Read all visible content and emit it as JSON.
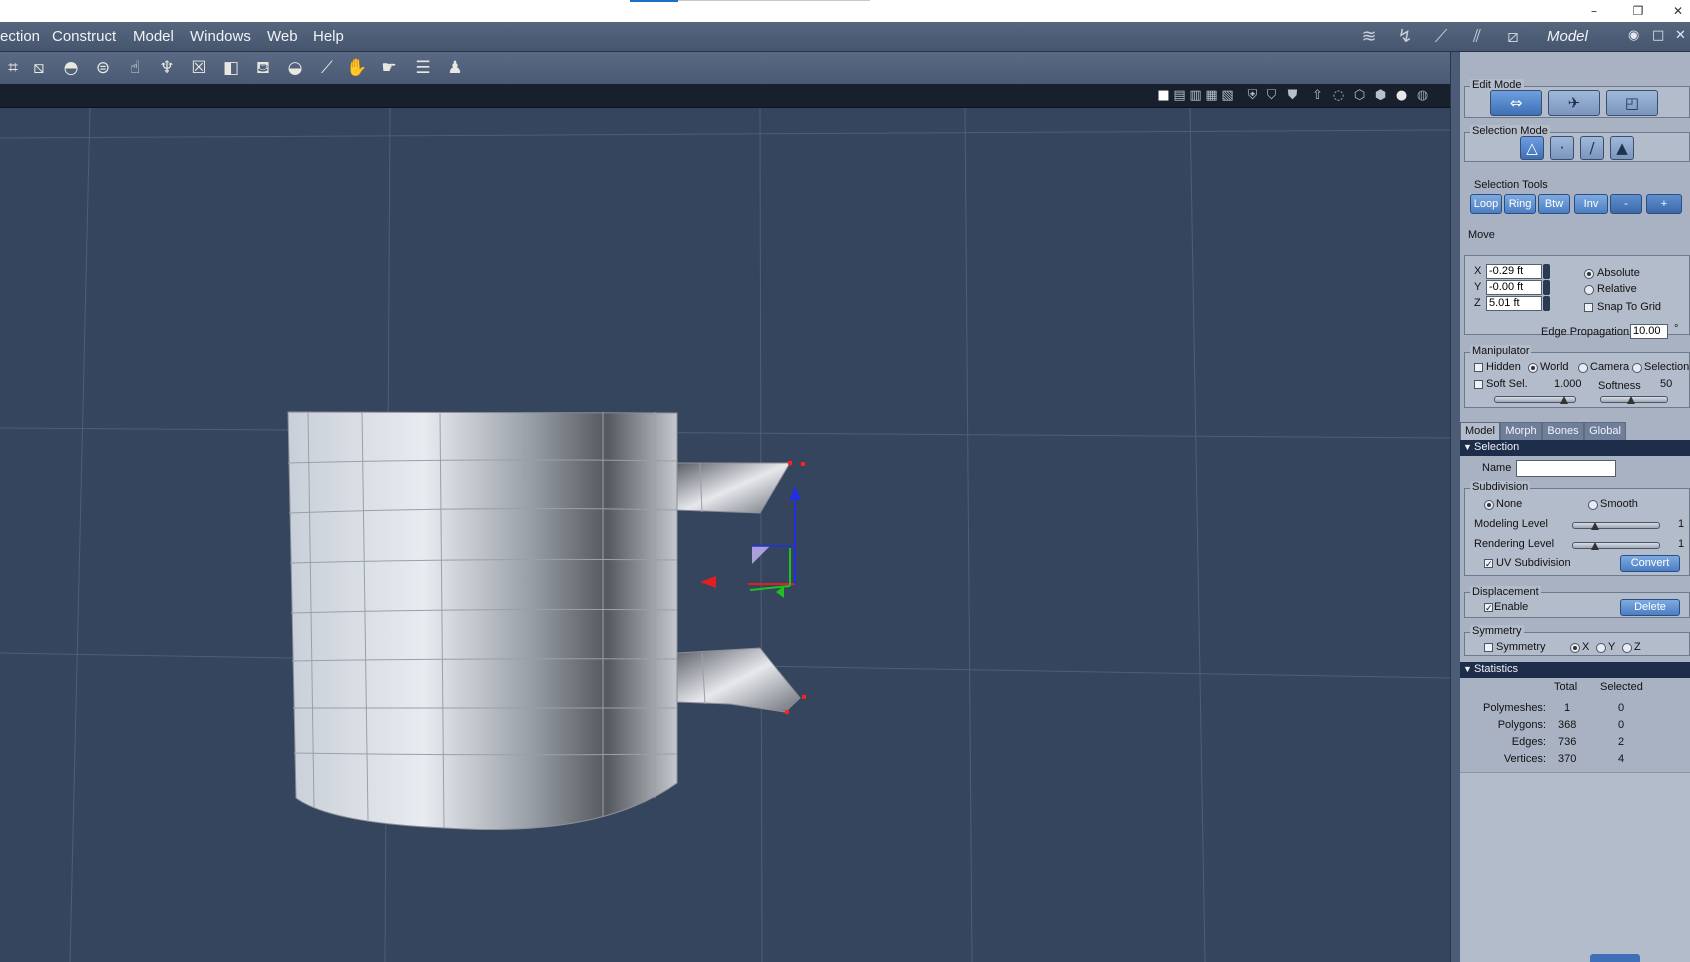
{
  "menu": {
    "items": [
      "ection",
      "Construct",
      "Model",
      "Windows",
      "Web",
      "Help"
    ],
    "room_title": "Model",
    "room_icons": [
      "pose-room-icon",
      "material-room-icon",
      "face-room-icon",
      "hair-room-icon",
      "cloth-room-icon"
    ]
  },
  "toolbar": {
    "tools": [
      "vertex-tool-icon",
      "frame-tool-icon",
      "dome-icon",
      "cylinder-shape-icon",
      "hand-shape-icon",
      "goblet-icon",
      "box-frame-icon",
      "cube-icon",
      "bag-icon",
      "bowl-icon",
      "knife-icon",
      "hand-move-icon",
      "hand-point-icon",
      "layers-icon",
      "figure-icon"
    ]
  },
  "viewport_bar": {
    "layout_icons": [
      "single-view-icon",
      "two-view-icon",
      "three-view-icon",
      "four-view-icon",
      "custom-view-icon"
    ],
    "display_icons": [
      "shield-icon",
      "shield-outline-icon",
      "shield-dot-icon",
      "arrow-up-icon",
      "dotted-sphere-icon",
      "wire-cube-icon",
      "shaded-cube-icon",
      "sphere-icon",
      "textured-sphere-icon"
    ]
  },
  "panel": {
    "edit_mode": {
      "title": "Edit Mode"
    },
    "selection_mode": {
      "title": "Selection Mode"
    },
    "selection_tools": {
      "title": "Selection Tools",
      "buttons": [
        "Loop",
        "Ring",
        "Btw",
        "Inv",
        "-",
        "+"
      ]
    },
    "move": {
      "title": "Move",
      "x_label": "X",
      "x_value": "-0.29 ft",
      "y_label": "Y",
      "y_value": "-0.00 ft",
      "z_label": "Z",
      "z_value": "5.01 ft",
      "absolute": "Absolute",
      "relative": "Relative",
      "snap": "Snap To Grid",
      "edge_prop_label": "Edge Propagation",
      "edge_prop_value": "10.00",
      "degree": "°"
    },
    "manipulator": {
      "title": "Manipulator",
      "hidden": "Hidden",
      "world": "World",
      "camera": "Camera",
      "selection": "Selection",
      "soft_sel": "Soft Sel.",
      "soft_sel_value": "1.000",
      "softness": "Softness",
      "softness_value": "50",
      "soft_sel_level": 1.0,
      "softness_level": 0.5
    },
    "tabs": [
      "Model",
      "Morph",
      "Bones",
      "Global"
    ],
    "selection_header": "Selection",
    "name_label": "Name",
    "name_value": "",
    "subdivision": {
      "title": "Subdivision",
      "none": "None",
      "smooth": "Smooth",
      "modeling": "Modeling Level",
      "modeling_value": "1",
      "rendering": "Rendering Level",
      "rendering_value": "1",
      "uv": "UV Subdivision",
      "convert": "Convert"
    },
    "displacement": {
      "title": "Displacement",
      "enable": "Enable",
      "delete": "Delete"
    },
    "symmetry": {
      "title": "Symmetry",
      "symmetry": "Symmetry",
      "x": "X",
      "y": "Y",
      "z": "Z"
    },
    "statistics": {
      "header": "Statistics",
      "col_total": "Total",
      "col_selected": "Selected",
      "rows": [
        {
          "label": "Polymeshes:",
          "total": "1",
          "selected": "0"
        },
        {
          "label": "Polygons:",
          "total": "368",
          "selected": "0"
        },
        {
          "label": "Edges:",
          "total": "736",
          "selected": "2"
        },
        {
          "label": "Vertices:",
          "total": "370",
          "selected": "4"
        }
      ]
    }
  }
}
